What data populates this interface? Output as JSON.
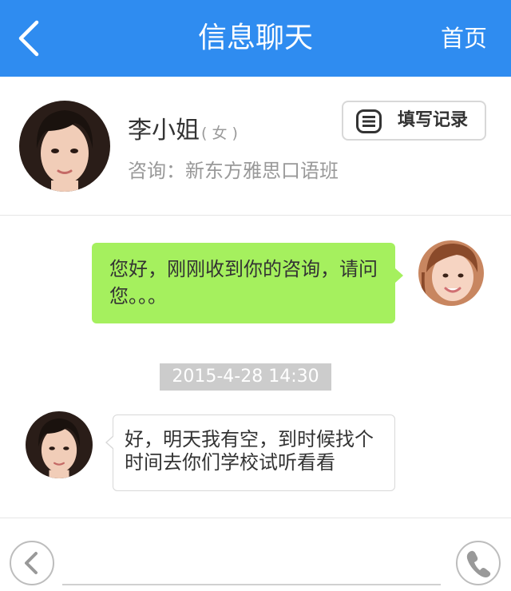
{
  "header": {
    "title": "信息聊天",
    "home_label": "首页",
    "back_icon": "chevron-left-icon",
    "background": "#2f8cf0"
  },
  "profile": {
    "name": "李小姐",
    "gender": "( 女 )",
    "consult": "咨询：新东方雅思口语班",
    "record_button_label": "填写记录",
    "record_icon": "list-icon"
  },
  "messages": [
    {
      "side": "right",
      "text": "您好，刚刚收到你的咨询，请问您。。。",
      "bubble_color": "#a5f05e"
    },
    {
      "side": "left",
      "text": "好，明天我有空，到时候找个时间去你们学校试听看看",
      "bubble_color": "#ffffff"
    }
  ],
  "chat": {
    "timestamp": "2015-4-28   14:30"
  },
  "footer": {
    "input_placeholder": "",
    "prev_icon": "chevron-left-icon",
    "call_icon": "phone-icon"
  }
}
